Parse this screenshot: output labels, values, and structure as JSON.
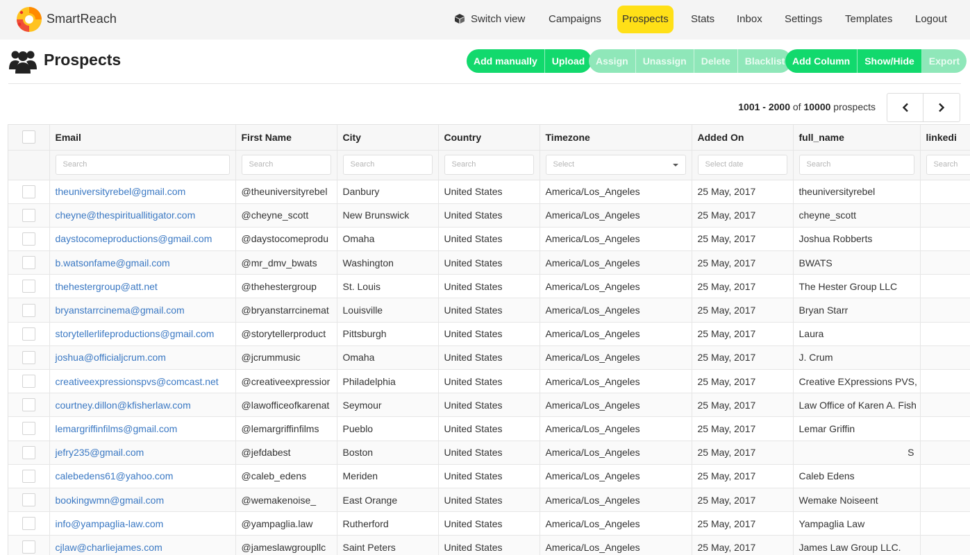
{
  "app": {
    "brand": "SmartReach"
  },
  "nav": {
    "switch_view": "Switch view",
    "items": [
      {
        "label": "Campaigns",
        "active": false
      },
      {
        "label": "Prospects",
        "active": true
      },
      {
        "label": "Stats",
        "active": false
      },
      {
        "label": "Inbox",
        "active": false
      },
      {
        "label": "Settings",
        "active": false
      },
      {
        "label": "Templates",
        "active": false
      },
      {
        "label": "Logout",
        "active": false
      }
    ]
  },
  "page": {
    "title": "Prospects"
  },
  "toolbar": {
    "group1": [
      "Add manually",
      "Upload"
    ],
    "group2": [
      "Assign",
      "Unassign",
      "Delete",
      "Blacklist"
    ],
    "group3": [
      "Add Column",
      "Show/Hide",
      "Export"
    ]
  },
  "pagination": {
    "range": "1001 - 2000",
    "of": "of",
    "total": "10000",
    "unit": "prospects"
  },
  "colors": {
    "accent_green": "#12d96d",
    "disabled_green": "#8fe7b9",
    "active_nav": "#ffe017",
    "link": "#3a78c3"
  },
  "table": {
    "columns": [
      "Email",
      "First Name",
      "City",
      "Country",
      "Timezone",
      "Added On",
      "full_name",
      "linkedi"
    ],
    "filters": [
      "Search",
      "Search",
      "Search",
      "Search",
      "Select",
      "Select date",
      "Search",
      "Search"
    ],
    "rows": [
      [
        "theuniversityrebel@gmail.com",
        "@theuniversityrebel",
        "Danbury",
        "United States",
        "America/Los_Angeles",
        "25 May, 2017",
        "theuniversityrebel",
        ""
      ],
      [
        "cheyne@thespirituallitigator.com",
        "@cheyne_scott",
        "New Brunswick",
        "United States",
        "America/Los_Angeles",
        "25 May, 2017",
        "cheyne_scott",
        ""
      ],
      [
        "daystocomeproductions@gmail.com",
        "@daystocomeprodu",
        "Omaha",
        "United States",
        "America/Los_Angeles",
        "25 May, 2017",
        "Joshua Robberts",
        ""
      ],
      [
        "b.watsonfame@gmail.com",
        "@mr_dmv_bwats",
        "Washington",
        "United States",
        "America/Los_Angeles",
        "25 May, 2017",
        "BWATS",
        ""
      ],
      [
        "thehestergroup@att.net",
        "@thehestergroup",
        "St. Louis",
        "United States",
        "America/Los_Angeles",
        "25 May, 2017",
        "The Hester Group LLC",
        ""
      ],
      [
        "bryanstarrcinema@gmail.com",
        "@bryanstarrcinemat",
        "Louisville",
        "United States",
        "America/Los_Angeles",
        "25 May, 2017",
        "Bryan Starr",
        ""
      ],
      [
        "storytellerlifeproductions@gmail.com",
        "@storytellerproduct",
        "Pittsburgh",
        "United States",
        "America/Los_Angeles",
        "25 May, 2017",
        "Laura",
        ""
      ],
      [
        "joshua@officialjcrum.com",
        "@jcrummusic",
        "Omaha",
        "United States",
        "America/Los_Angeles",
        "25 May, 2017",
        "J. Crum",
        ""
      ],
      [
        "creativeexpressionspvs@comcast.net",
        "@creativeexpressior",
        "Philadelphia",
        "United States",
        "America/Los_Angeles",
        "25 May, 2017",
        "Creative EXpressions PVS,",
        ""
      ],
      [
        "courtney.dillon@kfisherlaw.com",
        "@lawofficeofkarenat",
        "Seymour",
        "United States",
        "America/Los_Angeles",
        "25 May, 2017",
        "Law Office of Karen A. Fish",
        ""
      ],
      [
        "lemargriffinfilms@gmail.com",
        "@lemargriffinfilms",
        "Pueblo",
        "United States",
        "America/Los_Angeles",
        "25 May, 2017",
        "Lemar Griffin",
        ""
      ],
      [
        "jefry235@gmail.com",
        "@jefdabest",
        "Boston",
        "United States",
        "America/Los_Angeles",
        "25 May, 2017",
        "S",
        ""
      ],
      [
        "calebedens61@yahoo.com",
        "@caleb_edens",
        "Meriden",
        "United States",
        "America/Los_Angeles",
        "25 May, 2017",
        "Caleb Edens",
        ""
      ],
      [
        "bookingwmn@gmail.com",
        "@wemakenoise_",
        "East Orange",
        "United States",
        "America/Los_Angeles",
        "25 May, 2017",
        "Wemake Noiseent",
        ""
      ],
      [
        "info@yampaglia-law.com",
        "@yampaglia.law",
        "Rutherford",
        "United States",
        "America/Los_Angeles",
        "25 May, 2017",
        "Yampaglia Law",
        ""
      ],
      [
        "cjlaw@charliejames.com",
        "@jameslawgroupllc",
        "Saint Peters",
        "United States",
        "America/Los_Angeles",
        "25 May, 2017",
        "James Law Group LLC.",
        ""
      ]
    ]
  }
}
